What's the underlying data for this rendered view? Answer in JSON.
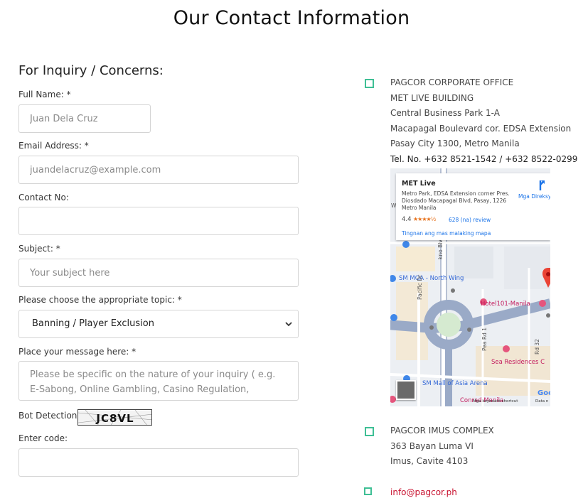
{
  "page": {
    "title": "Our Contact Information"
  },
  "form": {
    "heading": "For Inquiry / Concerns:",
    "full_name": {
      "label": "Full Name: *",
      "placeholder": "Juan Dela Cruz",
      "value": ""
    },
    "email": {
      "label": "Email Address: *",
      "placeholder": "juandelacruz@example.com",
      "value": ""
    },
    "contact": {
      "label": "Contact No:",
      "placeholder": "",
      "value": ""
    },
    "subject": {
      "label": "Subject: *",
      "placeholder": "Your subject here",
      "value": ""
    },
    "topic": {
      "label": "Please choose the appropriate topic: *",
      "selected": "Banning / Player Exclusion"
    },
    "message": {
      "label": "Place your message here: *",
      "placeholder": "Please be specific on the nature of your inquiry ( e.g. E-Sabong, Online Gambling, Casino Regulation, Request for Assistance, etc. )"
    },
    "bot_detection": {
      "label": "Bot Detection:",
      "captcha_text": "JC8VL"
    },
    "enter_code": {
      "label": "Enter code:",
      "value": ""
    }
  },
  "contacts": {
    "corporate": {
      "lines": [
        "PAGCOR CORPORATE OFFICE",
        "MET LIVE BUILDING",
        "Central Business Park 1-A",
        "Macapagal Boulevard cor. EDSA Extension",
        "Pasay City 1300, Metro Manila"
      ],
      "phone": "Tel. No. +632 8521-1542 / +632 8522-0299"
    },
    "imus": {
      "lines": [
        "PAGCOR IMUS COMPLEX",
        "363 Bayan Luma VI",
        "Imus, Cavite 4103"
      ]
    },
    "email": "info@pagcor.ph"
  },
  "map": {
    "place_name": "MET Live",
    "address": "Metro Park, EDSA Extension corner Pres. Diosdado Macapagal Blvd, Pasay, 1226 Metro Manila",
    "rating": "4.4",
    "stars": "★★★★½",
    "reviews": "628 (na) review",
    "larger_map": "Tingnan ang mas malaking mapa",
    "directions": "Mga Direksy",
    "labels": {
      "moa_north": "SM MOA - North Wing",
      "hotel101": "Hotel101-Manila",
      "sea_residences": "Sea Residences C",
      "moa_arena": "SM Mall of Asia Arena",
      "conrad": "Conrad Manila"
    },
    "streets": {
      "pacific": "Pacific Dr",
      "seaside": "kno Blvd",
      "pea": "Pea Rd 1",
      "rd32": "Rd 32",
      "w": "W"
    },
    "footer_shortcuts": "Mga keyboard shortcut",
    "footer_data": "Data n",
    "google": "Goo",
    "accent_colors": {
      "pin": "#ea4335",
      "link": "#1a73e8",
      "hotel": "#c2185b",
      "road": "#9aaac7"
    }
  },
  "colors": {
    "checkbox_border": "#3fbf95",
    "email_link": "#c8102e"
  }
}
